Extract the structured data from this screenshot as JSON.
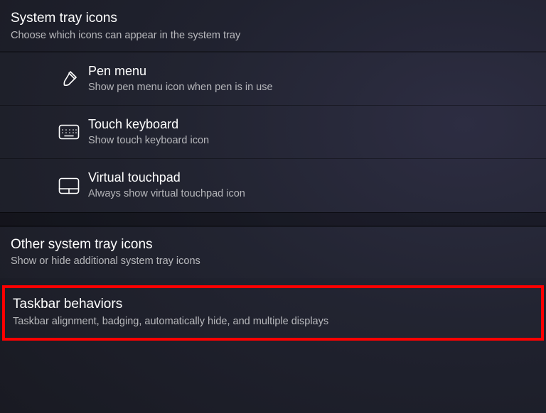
{
  "sections": {
    "systemTray": {
      "title": "System tray icons",
      "desc": "Choose which icons can appear in the system tray"
    },
    "otherTray": {
      "title": "Other system tray icons",
      "desc": "Show or hide additional system tray icons"
    },
    "taskbarBehaviors": {
      "title": "Taskbar behaviors",
      "desc": "Taskbar alignment, badging, automatically hide, and multiple displays"
    }
  },
  "items": {
    "penMenu": {
      "title": "Pen menu",
      "desc": "Show pen menu icon when pen is in use"
    },
    "touchKeyboard": {
      "title": "Touch keyboard",
      "desc": "Show touch keyboard icon"
    },
    "virtualTouchpad": {
      "title": "Virtual touchpad",
      "desc": "Always show virtual touchpad icon"
    }
  }
}
